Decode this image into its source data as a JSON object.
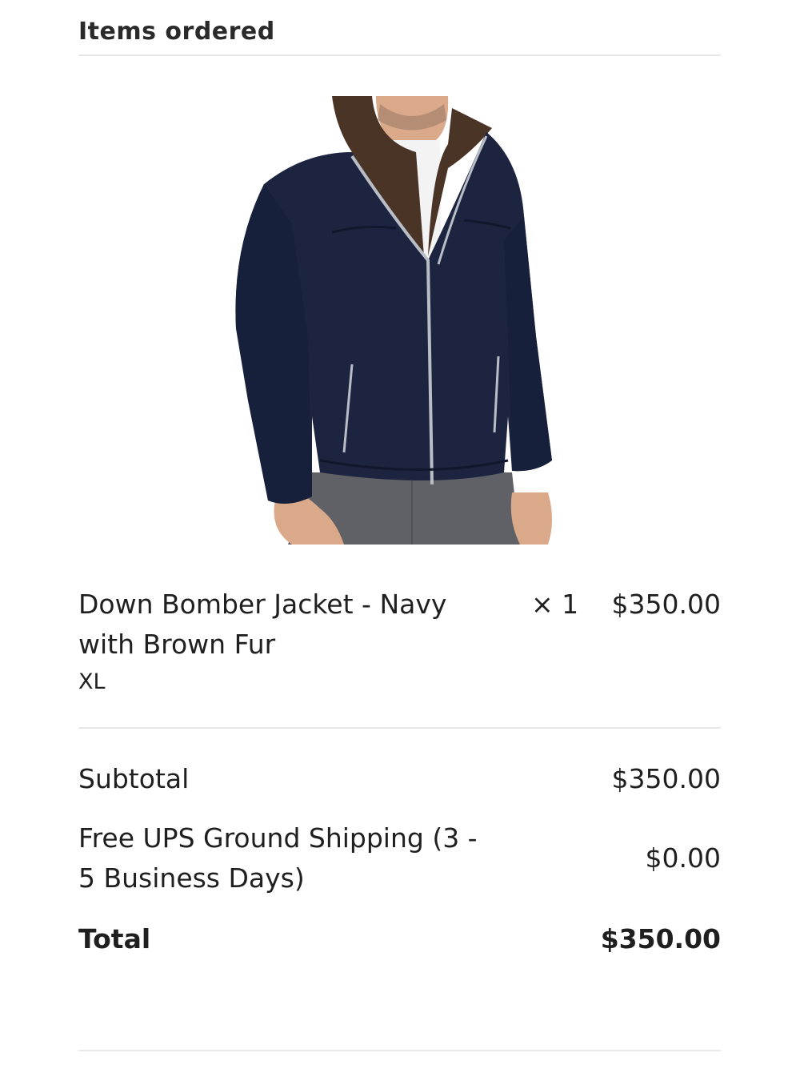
{
  "section": {
    "title": "Items ordered"
  },
  "item": {
    "image_alt": "Navy down bomber jacket with brown fur collar",
    "name": "Down Bomber Jacket - Navy with Brown Fur",
    "variant": "XL",
    "quantity": "× 1",
    "price": "$350.00"
  },
  "summary": {
    "subtotal_label": "Subtotal",
    "subtotal_value": "$350.00",
    "shipping_label": "Free UPS Ground Shipping (3 - 5 Business Days)",
    "shipping_value": "$0.00",
    "total_label": "Total",
    "total_value": "$350.00"
  },
  "colors": {
    "jacket": "#1c2440",
    "fur": "#4a3426",
    "pants": "#5f6166",
    "skin": "#d9a98a",
    "divider": "#e8e8e8"
  }
}
